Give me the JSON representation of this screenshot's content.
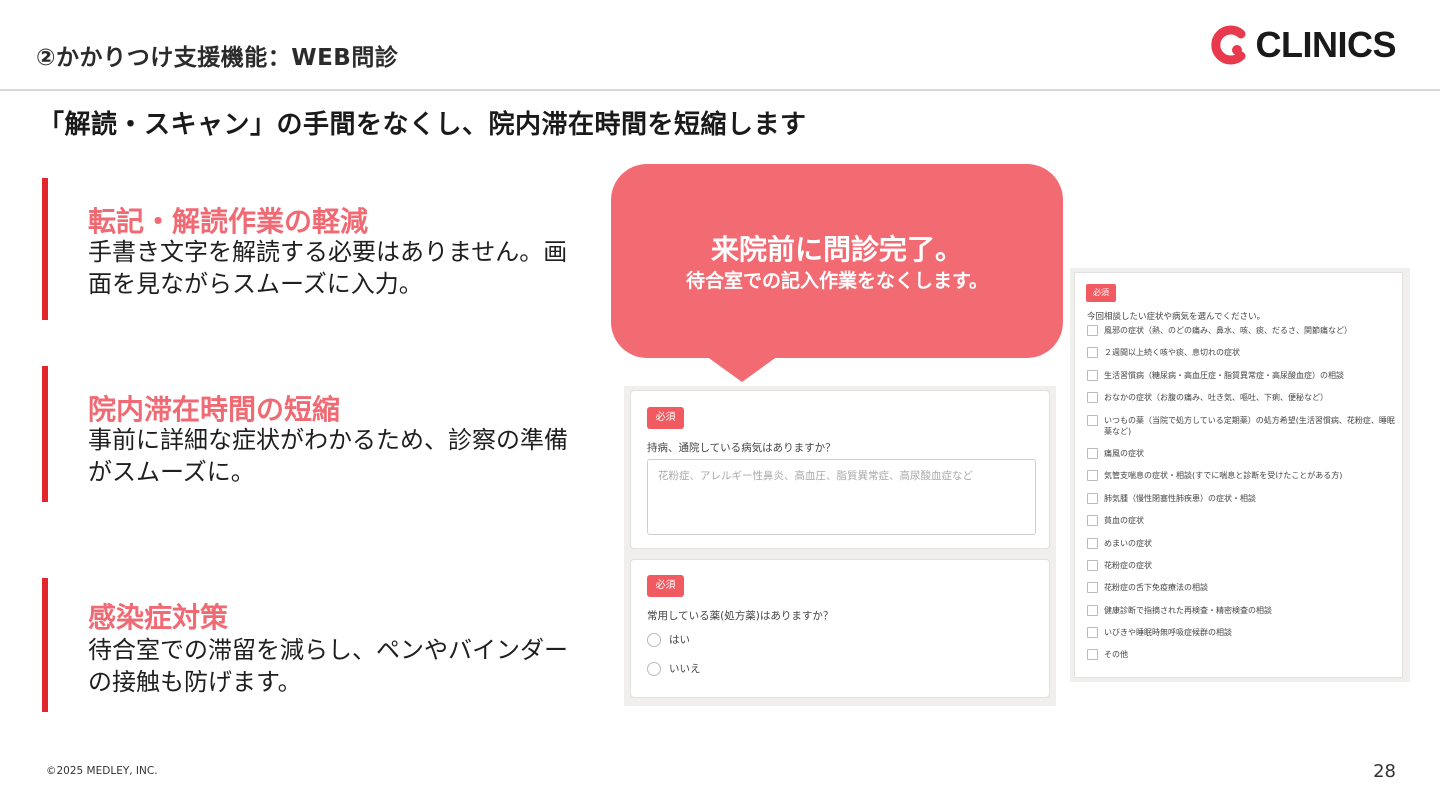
{
  "header": {
    "title": "②かかりつけ支援機能：WEB問診",
    "logo_text": "CLINICS"
  },
  "headline": "「解読・スキャン」の手間をなくし、院内滞在時間を短縮します",
  "points": [
    {
      "title": "転記・解読作業の軽減",
      "body": "手書き文字を解読する必要はありません。画面を見ながらスムーズに入力。"
    },
    {
      "title": "院内滞在時間の短縮",
      "body": "事前に詳細な症状がわかるため、診察の準備がスムーズに。"
    },
    {
      "title": "感染症対策",
      "body": "待合室での滞留を減らし、ペンやバインダーの接触も防げます。"
    }
  ],
  "bubble": {
    "line1": "来院前に問診完了。",
    "line2": "待合室での記入作業をなくします。"
  },
  "form_left": {
    "card1": {
      "required": "必須",
      "question": "持病、通院している病気はありますか？",
      "placeholder": "花粉症、アレルギー性鼻炎、高血圧、脂質異常症、高尿酸血症など"
    },
    "card2": {
      "required": "必須",
      "question": "常用している薬(処方薬)はありますか？",
      "options": [
        "はい",
        "いいえ"
      ]
    }
  },
  "form_right": {
    "required": "必須",
    "question": "今回相談したい症状や病気を選んでください。",
    "options": [
      "風邪の症状（熱、のどの痛み、鼻水、咳、痰、だるさ、関節痛など）",
      "２週間以上続く咳や痰、息切れの症状",
      "生活習慣病（糖尿病・高血圧症・脂質異常症・高尿酸血症）の相談",
      "おなかの症状（お腹の痛み、吐き気、嘔吐、下痢、便秘など）",
      "いつもの薬（当院で処方している定期薬）の処方希望(生活習慣病、花粉症、睡眠薬など)",
      "痛風の症状",
      "気管支喘息の症状・相談(すでに喘息と診断を受けたことがある方)",
      "肺気腫（慢性閉塞性肺疾患）の症状・相談",
      "貧血の症状",
      "めまいの症状",
      "花粉症の症状",
      "花粉症の舌下免疫療法の相談",
      "健康診断で指摘された再検査・精密検査の相談",
      "いびきや睡眠時無呼吸症候群の相談",
      "その他"
    ]
  },
  "footer": {
    "copyright": "©2025 MEDLEY, INC.",
    "page": "28"
  },
  "colors": {
    "accent": "#f26b73",
    "bar": "#e3262e",
    "point_title": "#f06a74",
    "required_badge": "#f05a60"
  }
}
